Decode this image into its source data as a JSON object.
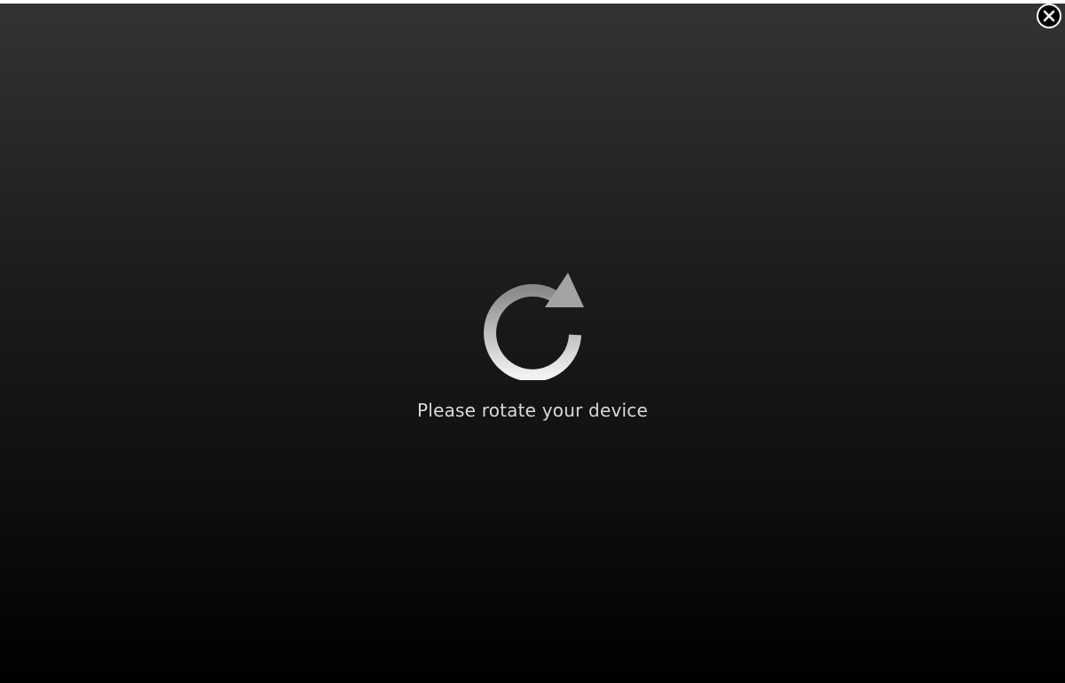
{
  "overlay": {
    "message": "Please rotate your device",
    "icon": "rotate-clockwise-icon"
  },
  "close_button": {
    "icon": "close-icon"
  }
}
